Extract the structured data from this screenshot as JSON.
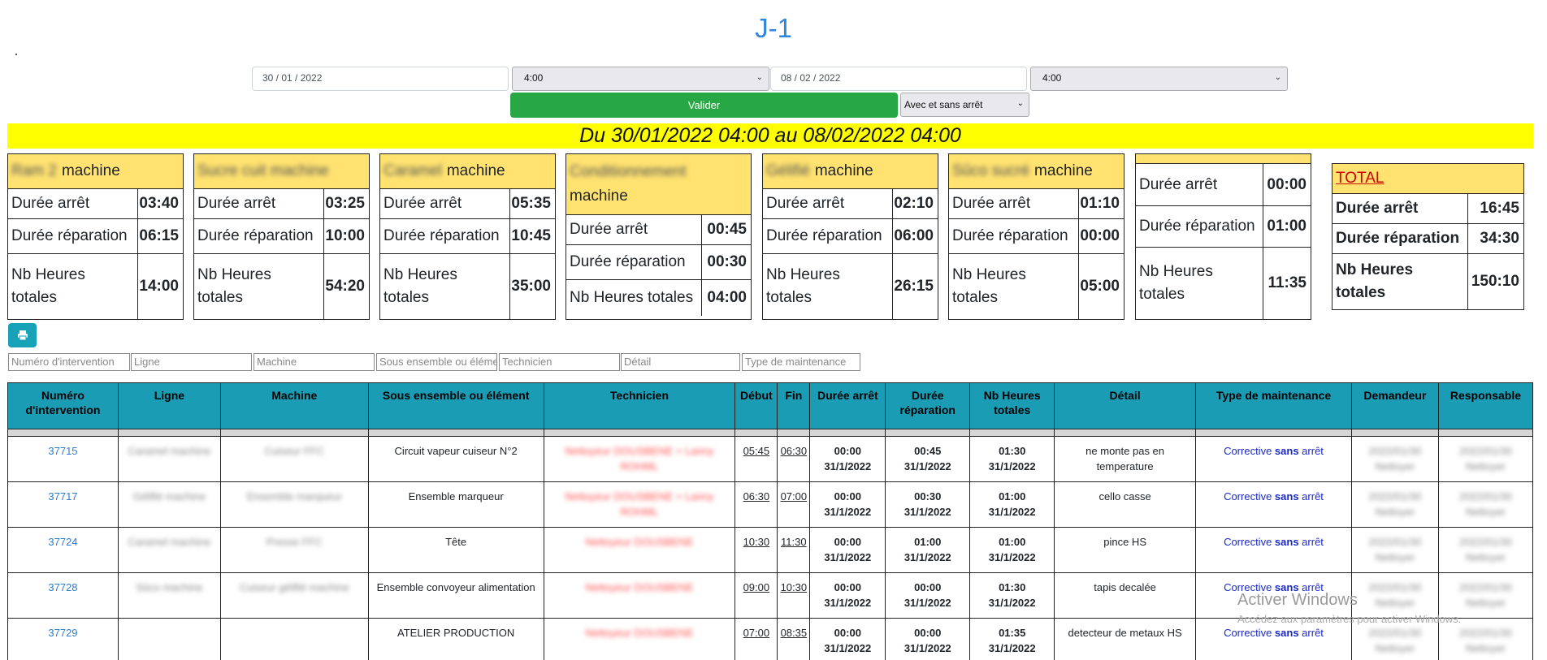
{
  "title": "J-1",
  "form": {
    "date_start": "30 / 01 / 2022",
    "time_start": "4:00",
    "date_end": "08 / 02 / 2022",
    "time_end": "4:00",
    "validate_label": "Valider",
    "filter_option": "Avec et sans arrêt"
  },
  "banner": "Du 30/01/2022 04:00 au 08/02/2022 04:00",
  "labels": {
    "duree_arret": "Durée arrêt",
    "duree_reparation": "Durée réparation",
    "nb_heures": "Nb Heures totales",
    "machine": "machine",
    "total": "TOTAL"
  },
  "cards": [
    {
      "name_blur": "Ram 2",
      "arret": "03:40",
      "reparation": "06:15",
      "heures": "14:00"
    },
    {
      "name_blur": "Sucre cuit machine",
      "arret": "03:25",
      "reparation": "10:00",
      "heures": "54:20"
    },
    {
      "name_blur": "Caramel",
      "arret": "05:35",
      "reparation": "10:45",
      "heures": "35:00"
    },
    {
      "name_blur": "Conditionnement",
      "arret": "00:45",
      "reparation": "00:30",
      "heures": "04:00"
    },
    {
      "name_blur": "Gélifié",
      "arret": "02:10",
      "reparation": "06:00",
      "heures": "26:15"
    },
    {
      "name_blur": "Sûco sucré",
      "arret": "01:10",
      "reparation": "00:00",
      "heures": "05:00"
    },
    {
      "name_blur": "",
      "arret": "00:00",
      "reparation": "01:00",
      "heures": "11:35"
    }
  ],
  "total": {
    "arret": "16:45",
    "reparation": "34:30",
    "heures": "150:10"
  },
  "filters": [
    "Numéro d'intervention",
    "Ligne",
    "Machine",
    "Sous ensemble ou élément",
    "Technicien",
    "Détail",
    "Type de maintenance"
  ],
  "table": {
    "headers": [
      "Numéro d'intervention",
      "Ligne",
      "Machine",
      "Sous ensemble ou élément",
      "Technicien",
      "Début",
      "Fin",
      "Durée arrêt",
      "Durée réparation",
      "Nb Heures totales",
      "Détail",
      "Type de maintenance",
      "Demandeur",
      "Responsable"
    ],
    "rows": [
      {
        "num": "37715",
        "ligne": "Caramel machine",
        "machine": "Cuiseur FFC",
        "sous": "Circuit vapeur cuiseur N°2",
        "tech": "Nettoyeur DOUSBENE + Lanny ROHML",
        "debut": "05:45",
        "fin": "06:30",
        "arret": "00:00",
        "rep": "00:45",
        "heures": "01:30",
        "date": "31/1/2022",
        "detail": "ne monte pas en temperature",
        "maint_a": "Corrective",
        "maint_b": "sans",
        "maint_c": "arrêt",
        "dem": "2022/01/30 Nettoyer",
        "resp": "2022/01/30 Nettoyer"
      },
      {
        "num": "37717",
        "ligne": "Gélifié machine",
        "machine": "Ensemble marqueur",
        "sous": "Ensemble marqueur",
        "tech": "Nettoyeur DOUSBENE + Lanny ROHML",
        "debut": "06:30",
        "fin": "07:00",
        "arret": "00:00",
        "rep": "00:30",
        "heures": "01:00",
        "date": "31/1/2022",
        "detail": "cello casse",
        "maint_a": "Corrective",
        "maint_b": "sans",
        "maint_c": "arrêt",
        "dem": "2022/01/30 Nettoyer",
        "resp": "2022/01/30 Nettoyer"
      },
      {
        "num": "37724",
        "ligne": "Caramel machine",
        "machine": "Presse FFC",
        "sous": "Tête",
        "tech": "Nettoyeur DOUSBENE",
        "debut": "10:30",
        "fin": "11:30",
        "arret": "00:00",
        "rep": "01:00",
        "heures": "01:00",
        "date": "31/1/2022",
        "detail": "pince HS",
        "maint_a": "Corrective",
        "maint_b": "sans",
        "maint_c": "arrêt",
        "dem": "2022/01/30 Nettoyer",
        "resp": "2022/01/30 Nettoyer"
      },
      {
        "num": "37728",
        "ligne": "Sûco machine",
        "machine": "Cuiseur gélifié machine",
        "sous": "Ensemble convoyeur alimentation",
        "tech": "Nettoyeur DOUSBENE",
        "debut": "09:00",
        "fin": "10:30",
        "arret": "00:00",
        "rep": "00:00",
        "heures": "01:30",
        "date": "31/1/2022",
        "detail": "tapis decalée",
        "maint_a": "Corrective",
        "maint_b": "sans",
        "maint_c": "arrêt",
        "dem": "2022/01/30 Nettoyer",
        "resp": "2022/01/30 Nettoyer"
      },
      {
        "num": "37729",
        "ligne": "",
        "machine": "",
        "sous": "ATELIER PRODUCTION",
        "tech": "Nettoyeur DOUSBENE",
        "debut": "07:00",
        "fin": "08:35",
        "arret": "00:00",
        "rep": "00:00",
        "heures": "01:35",
        "date": "31/1/2022",
        "detail": "detecteur de metaux HS",
        "maint_a": "Corrective",
        "maint_b": "sans",
        "maint_c": "arrêt",
        "dem": "2022/01/30 Nettoyer",
        "resp": "2022/01/30 Nettoyer"
      }
    ]
  },
  "watermark": {
    "title": "Activer Windows",
    "subtitle": "Accédez aux paramètres pour activer Windows."
  }
}
